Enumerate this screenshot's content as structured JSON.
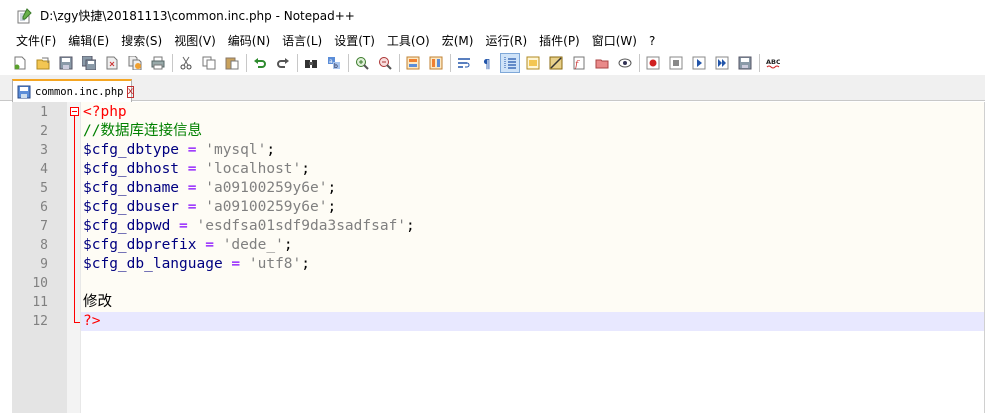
{
  "window": {
    "title": "D:\\zgy快捷\\20181113\\common.inc.php - Notepad++",
    "app_icon": "notepad-plus-plus-icon"
  },
  "menu": {
    "items": [
      {
        "label": "文件(F)"
      },
      {
        "label": "编辑(E)"
      },
      {
        "label": "搜索(S)"
      },
      {
        "label": "视图(V)"
      },
      {
        "label": "编码(N)"
      },
      {
        "label": "语言(L)"
      },
      {
        "label": "设置(T)"
      },
      {
        "label": "工具(O)"
      },
      {
        "label": "宏(M)"
      },
      {
        "label": "运行(R)"
      },
      {
        "label": "插件(P)"
      },
      {
        "label": "窗口(W)"
      },
      {
        "label": "?"
      }
    ]
  },
  "toolbar": {
    "buttons": [
      "new-file-icon",
      "open-file-icon",
      "save-icon",
      "save-all-icon",
      "close-icon",
      "close-all-icon",
      "print-icon",
      "cut-icon",
      "copy-icon",
      "paste-icon",
      "undo-icon",
      "redo-icon",
      "find-icon",
      "replace-icon",
      "zoom-in-icon",
      "zoom-out-icon",
      "sync-vertical-icon",
      "sync-horizontal-icon",
      "word-wrap-icon",
      "show-all-characters-icon",
      "indent-guide-icon",
      "language-icon",
      "doc-map-icon",
      "function-list-icon",
      "folder-workspace-icon",
      "monitor-icon",
      "record-macro-icon",
      "stop-macro-icon",
      "play-macro-icon",
      "run-macro-multiple-icon",
      "save-macro-icon",
      "spell-check-icon"
    ],
    "spell_check_label": "ABC"
  },
  "tabs": [
    {
      "label": "common.inc.php",
      "close": "x"
    }
  ],
  "editor": {
    "line_numbers": [
      "1",
      "2",
      "3",
      "4",
      "5",
      "6",
      "7",
      "8",
      "9",
      "10",
      "11",
      "12"
    ],
    "lines": [
      {
        "tokens": [
          {
            "t": "php",
            "v": "<?php"
          }
        ]
      },
      {
        "tokens": [
          {
            "t": "comment",
            "v": "//数据库连接信息"
          }
        ]
      },
      {
        "tokens": [
          {
            "t": "var",
            "v": "$cfg_dbtype"
          },
          {
            "t": "op",
            "v": " = "
          },
          {
            "t": "str",
            "v": "'mysql'"
          },
          {
            "t": "semi",
            "v": ";"
          }
        ]
      },
      {
        "tokens": [
          {
            "t": "var",
            "v": "$cfg_dbhost"
          },
          {
            "t": "op",
            "v": " = "
          },
          {
            "t": "str",
            "v": "'localhost'"
          },
          {
            "t": "semi",
            "v": ";"
          }
        ]
      },
      {
        "tokens": [
          {
            "t": "var",
            "v": "$cfg_dbname"
          },
          {
            "t": "op",
            "v": " = "
          },
          {
            "t": "str",
            "v": "'a09100259y6e'"
          },
          {
            "t": "semi",
            "v": ";"
          }
        ]
      },
      {
        "tokens": [
          {
            "t": "var",
            "v": "$cfg_dbuser"
          },
          {
            "t": "op",
            "v": " = "
          },
          {
            "t": "str",
            "v": "'a09100259y6e'"
          },
          {
            "t": "semi",
            "v": ";"
          }
        ]
      },
      {
        "tokens": [
          {
            "t": "var",
            "v": "$cfg_dbpwd"
          },
          {
            "t": "op",
            "v": " = "
          },
          {
            "t": "str",
            "v": "'esdfsa01sdf9da3sadfsaf'"
          },
          {
            "t": "semi",
            "v": ";"
          }
        ]
      },
      {
        "tokens": [
          {
            "t": "var",
            "v": "$cfg_dbprefix"
          },
          {
            "t": "op",
            "v": " = "
          },
          {
            "t": "str",
            "v": "'dede_'"
          },
          {
            "t": "semi",
            "v": ";"
          }
        ]
      },
      {
        "tokens": [
          {
            "t": "var",
            "v": "$cfg_db_language"
          },
          {
            "t": "op",
            "v": " = "
          },
          {
            "t": "str",
            "v": "'utf8'"
          },
          {
            "t": "semi",
            "v": ";"
          }
        ]
      },
      {
        "tokens": []
      },
      {
        "tokens": [
          {
            "t": "plain",
            "v": "修改"
          }
        ]
      },
      {
        "tokens": [
          {
            "t": "php",
            "v": "?>"
          }
        ]
      }
    ]
  }
}
